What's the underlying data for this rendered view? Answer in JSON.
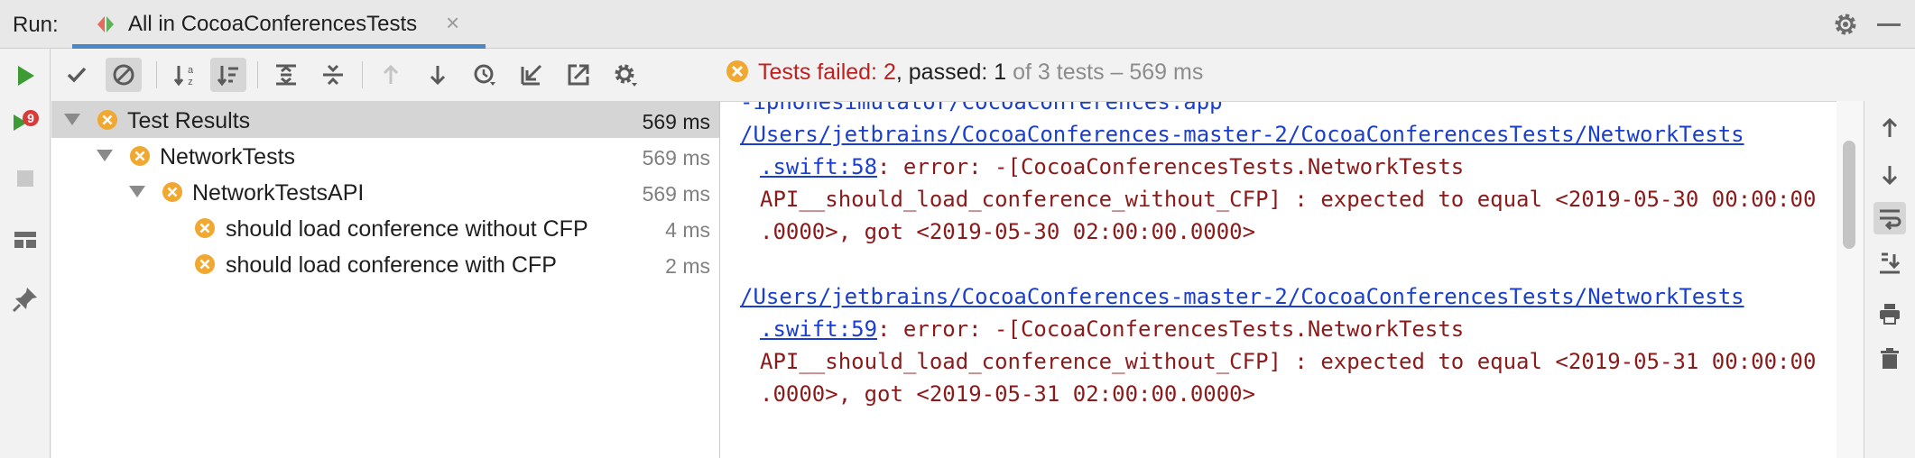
{
  "header": {
    "run_label": "Run:",
    "tab_title": "All in CocoaConferencesTests",
    "tab_close": "×"
  },
  "status": {
    "failed": "Tests failed: 2",
    "sep1": ", ",
    "passed": "passed: 1",
    "rest": " of 3 tests – 569 ms"
  },
  "tree": {
    "rows": [
      {
        "label": "Test Results",
        "time": "569 ms"
      },
      {
        "label": "NetworkTests",
        "time": "569 ms"
      },
      {
        "label": "NetworkTestsAPI",
        "time": "569 ms"
      },
      {
        "label": "should load conference without CFP",
        "time": "4 ms"
      },
      {
        "label": "should load conference with CFP",
        "time": "2 ms"
      }
    ]
  },
  "console": {
    "lines": [
      "-iphonesimulator/CocoaConferences.app",
      "/Users/jetbrains/CocoaConferences-master-2/CocoaConferencesTests/NetworkTests",
      ".swift:58",
      ": error: -[CocoaConferencesTests.NetworkTests",
      "API__should_load_conference_without_CFP] : expected to equal <2019-05-30 00:00:00",
      ".0000>, got <2019-05-30 02:00:00.0000>",
      "/Users/jetbrains/CocoaConferences-master-2/CocoaConferencesTests/NetworkTests",
      ".swift:59",
      ": error: -[CocoaConferencesTests.NetworkTests",
      "API__should_load_conference_without_CFP] : expected to equal <2019-05-31 00:00:00",
      ".0000>, got <2019-05-31 02:00:00.0000>"
    ]
  },
  "colors": {
    "failed": "#c21f1f",
    "link": "#1a3fcf",
    "error_text": "#8b1b1b",
    "warning_icon": "#f0a830",
    "run_green": "#3d9b35",
    "tab_accent": "#4a88c7"
  },
  "icons": {
    "rerun_failed_badge": "9"
  }
}
